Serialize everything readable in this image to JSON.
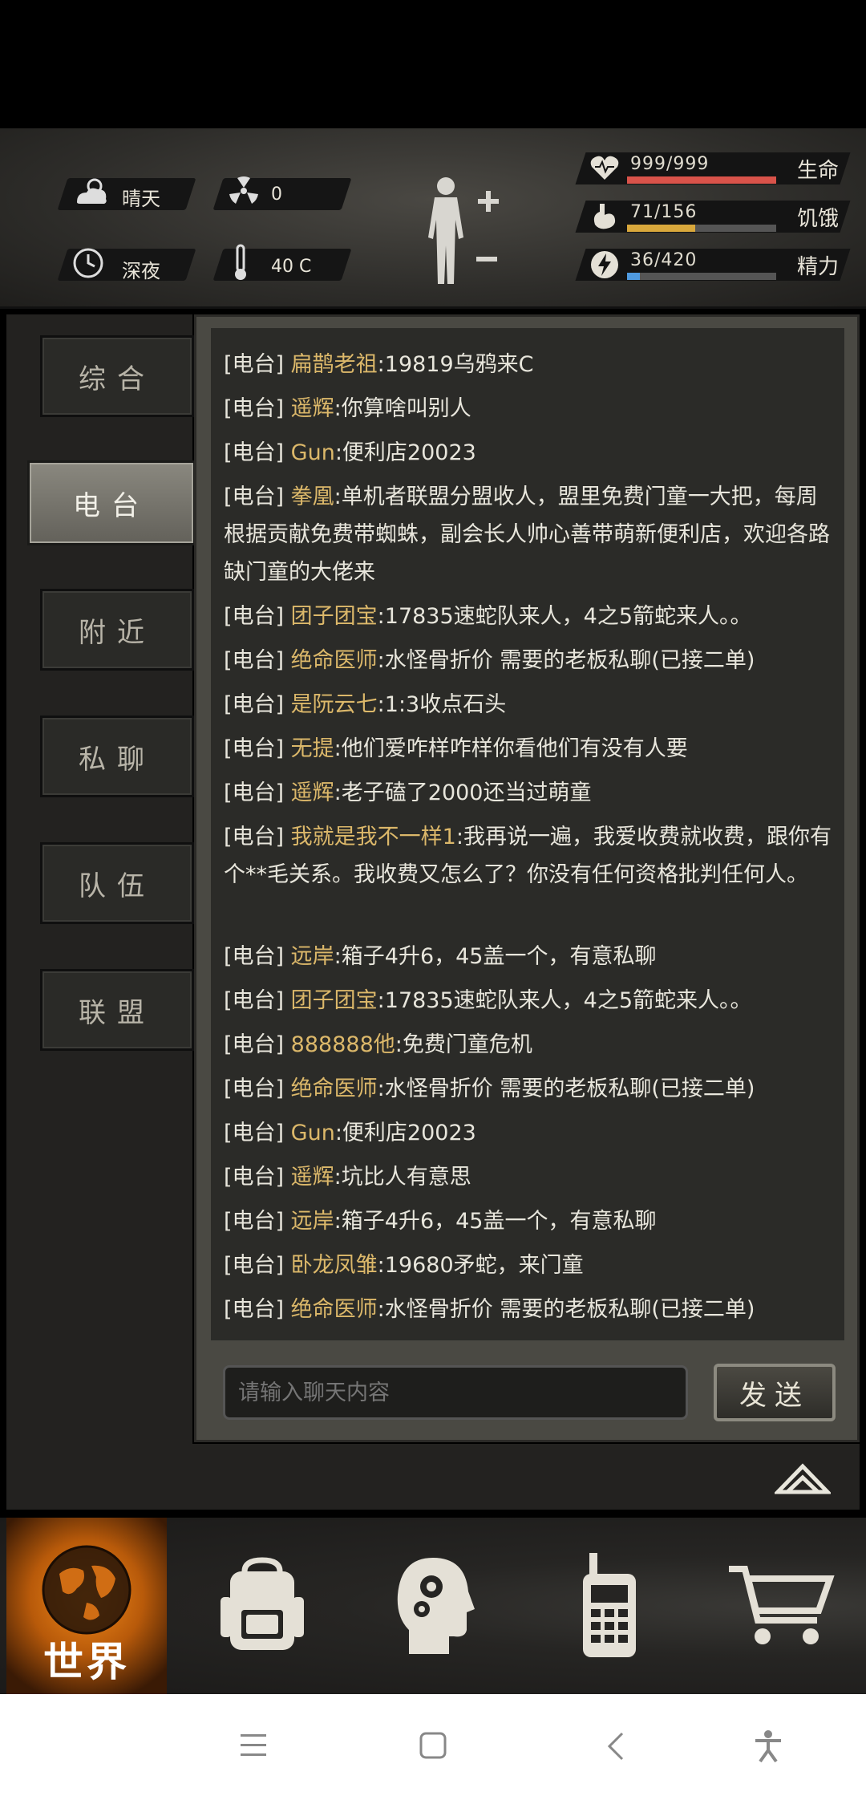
{
  "status": {
    "weather": {
      "icon": "cloud-sun-icon",
      "label": "晴天"
    },
    "radiation": {
      "icon": "radiation-icon",
      "value": "0"
    },
    "time_of_day": {
      "icon": "clock-icon",
      "label": "深夜"
    },
    "temperature": {
      "icon": "thermometer-icon",
      "value": "40 C"
    },
    "vitals": [
      {
        "icon": "heart-icon",
        "value": "999/999",
        "label": "生命",
        "fraction": 1.0,
        "color": "#d9534a"
      },
      {
        "icon": "stomach-icon",
        "value": "71/156",
        "label": "饥饿",
        "fraction": 0.455,
        "color": "#d9a83c"
      },
      {
        "icon": "energy-icon",
        "value": "36/420",
        "label": "精力",
        "fraction": 0.086,
        "color": "#4f9ae0"
      }
    ]
  },
  "tabs": [
    {
      "label": "综合",
      "active": false
    },
    {
      "label": "电台",
      "active": true
    },
    {
      "label": "附近",
      "active": false
    },
    {
      "label": "私聊",
      "active": false
    },
    {
      "label": "队伍",
      "active": false
    },
    {
      "label": "联盟",
      "active": false
    }
  ],
  "chat": {
    "messages": [
      {
        "channel": "[电台]",
        "name": "扁鹊老祖",
        "text": ":19819乌鸦来C"
      },
      {
        "channel": "[电台]",
        "name": "遥辉",
        "text": ":你算啥叫别人"
      },
      {
        "channel": "[电台]",
        "name": "Gun",
        "text": ":便利店20023"
      },
      {
        "channel": "[电台]",
        "name": "拳凰",
        "text": ":单机者联盟分盟收人，盟里免费门童一大把，每周根据贡献免费带蜘蛛，副会长人帅心善带萌新便利店，欢迎各路缺门童的大佬来"
      },
      {
        "channel": "[电台]",
        "name": "团子团宝",
        "text": ":17835速蛇队来人，4之5箭蛇来人。。"
      },
      {
        "channel": "[电台]",
        "name": "绝命医师",
        "text": ":水怪骨折价 需要的老板私聊(已接二单)"
      },
      {
        "channel": "[电台]",
        "name": "是阮云七",
        "text": ":1:3收点石头"
      },
      {
        "channel": "[电台]",
        "name": "无提",
        "text": ":他们爱咋样咋样你看他们有没有人要"
      },
      {
        "channel": "[电台]",
        "name": "遥辉",
        "text": ":老子磕了2000还当过萌童"
      },
      {
        "channel": "[电台]",
        "name": "我就是我不一样1",
        "text": ":我再说一遍，我爱收费就收费，跟你有个**毛关系。我收费又怎么了？你没有任何资格批判任何人。"
      },
      {
        "channel": "[电台]",
        "name": "远岸",
        "text": ":箱子4升6，45盖一个，有意私聊"
      },
      {
        "channel": "[电台]",
        "name": "团子团宝",
        "text": ":17835速蛇队来人，4之5箭蛇来人。。"
      },
      {
        "channel": "[电台]",
        "name": "888888他",
        "text": ":免费门童危机"
      },
      {
        "channel": "[电台]",
        "name": "绝命医师",
        "text": ":水怪骨折价 需要的老板私聊(已接二单)"
      },
      {
        "channel": "[电台]",
        "name": "Gun",
        "text": ":便利店20023"
      },
      {
        "channel": "[电台]",
        "name": "遥辉",
        "text": ":坑比人有意思"
      },
      {
        "channel": "[电台]",
        "name": "远岸",
        "text": ":箱子4升6，45盖一个，有意私聊"
      },
      {
        "channel": "[电台]",
        "name": "卧龙凤雏",
        "text": ":19680矛蛇，来门童"
      },
      {
        "channel": "[电台]",
        "name": "绝命医师",
        "text": ":水怪骨折价 需要的老板私聊(已接二单)"
      }
    ],
    "input_placeholder": "请输入聊天内容",
    "send_label": "发送"
  },
  "bottom_nav": {
    "world_label": "世界",
    "items": [
      "globe-icon",
      "backpack-icon",
      "head-gears-icon",
      "radio-icon",
      "cart-icon"
    ]
  },
  "system_nav": [
    "menu-icon",
    "home-icon",
    "back-icon",
    "accessibility-icon"
  ],
  "colors": {
    "name_color": "#dcb86a",
    "active_tab": "#8a887f",
    "world_orange": "#f28a1a"
  }
}
